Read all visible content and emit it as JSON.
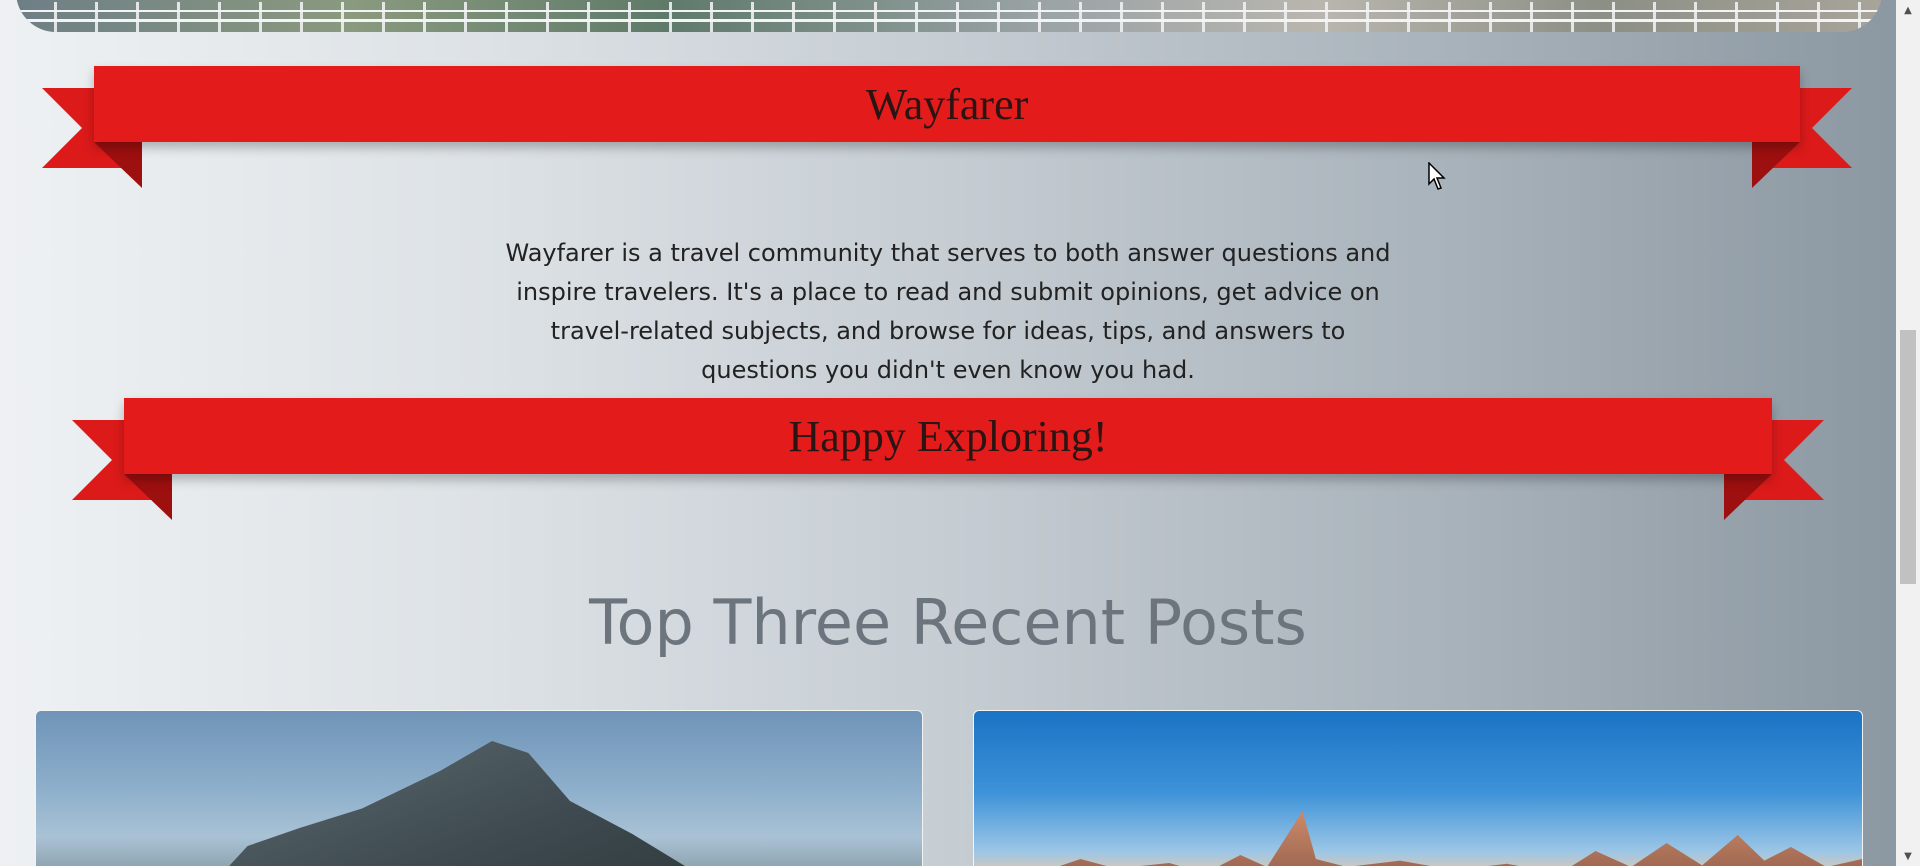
{
  "hero": {
    "image_alt": "scenic overlook with railing"
  },
  "banner_top": {
    "title": "Wayfarer"
  },
  "intro": {
    "text": "Wayfarer is a travel community that serves to both answer questions and inspire travelers. It's a place to read and submit opinions, get advice on travel-related subjects, and browse for ideas, tips, and answers to questions you didn't even know you had."
  },
  "banner_bottom": {
    "title": "Happy Exploring!"
  },
  "section": {
    "title": "Top Three Recent Posts"
  },
  "cards": [
    {
      "image": "rock-of-gibraltar-photo"
    },
    {
      "image": "city-skyline-photo"
    }
  ],
  "colors": {
    "ribbon": "#e31b1b",
    "ribbon_fold": "#9e0f0f",
    "section_title": "#6c757d"
  }
}
